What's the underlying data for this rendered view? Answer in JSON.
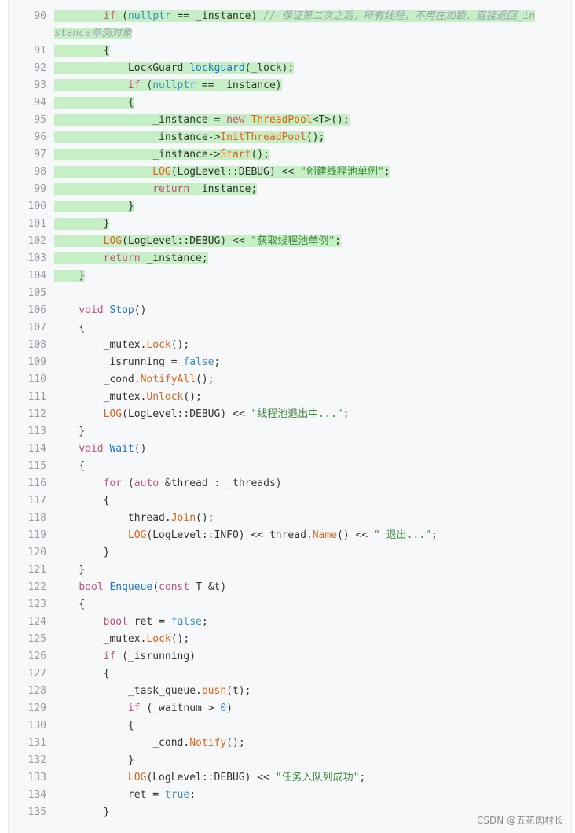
{
  "watermark": "CSDN @五花肉村长",
  "lines": [
    {
      "n": "90",
      "hl": true,
      "tall": true,
      "tokens": [
        {
          "t": "        "
        },
        {
          "t": "if",
          "c": "t-kw"
        },
        {
          "t": " ("
        },
        {
          "t": "nullptr",
          "c": "t-lit"
        },
        {
          "t": " == _instance) "
        },
        {
          "t": "// 保证第二次之后，所有线程，不用在加锁，直接返回_instance单例对象",
          "c": "t-com"
        }
      ]
    },
    {
      "n": "91",
      "hl": true,
      "tokens": [
        {
          "t": "        {"
        }
      ]
    },
    {
      "n": "92",
      "hl": true,
      "tokens": [
        {
          "t": "            LockGuard "
        },
        {
          "t": "lockguard",
          "c": "t-fn2"
        },
        {
          "t": "(_lock);"
        }
      ]
    },
    {
      "n": "93",
      "hl": true,
      "tokens": [
        {
          "t": "            "
        },
        {
          "t": "if",
          "c": "t-kw"
        },
        {
          "t": " ("
        },
        {
          "t": "nullptr",
          "c": "t-lit"
        },
        {
          "t": " == _instance)"
        }
      ]
    },
    {
      "n": "94",
      "hl": true,
      "tokens": [
        {
          "t": "            {"
        }
      ]
    },
    {
      "n": "95",
      "hl": true,
      "tokens": [
        {
          "t": "                _instance = "
        },
        {
          "t": "new",
          "c": "t-kw"
        },
        {
          "t": " "
        },
        {
          "t": "ThreadPool",
          "c": "t-ty"
        },
        {
          "t": "<T>();"
        }
      ]
    },
    {
      "n": "96",
      "hl": true,
      "tokens": [
        {
          "t": "                _instance->"
        },
        {
          "t": "InitThreadPool",
          "c": "t-fn"
        },
        {
          "t": "();"
        }
      ]
    },
    {
      "n": "97",
      "hl": true,
      "tokens": [
        {
          "t": "                _instance->"
        },
        {
          "t": "Start",
          "c": "t-fn"
        },
        {
          "t": "();"
        }
      ]
    },
    {
      "n": "98",
      "hl": true,
      "tokens": [
        {
          "t": "                "
        },
        {
          "t": "LOG",
          "c": "t-fn"
        },
        {
          "t": "(LogLevel::DEBUG) << "
        },
        {
          "t": "\"创建线程池单例\"",
          "c": "t-str"
        },
        {
          "t": ";"
        }
      ]
    },
    {
      "n": "99",
      "hl": true,
      "tokens": [
        {
          "t": "                "
        },
        {
          "t": "return",
          "c": "t-kw"
        },
        {
          "t": " _instance;"
        }
      ]
    },
    {
      "n": "100",
      "hl": true,
      "tokens": [
        {
          "t": "            }"
        }
      ]
    },
    {
      "n": "101",
      "hl": true,
      "tokens": [
        {
          "t": "        }"
        }
      ]
    },
    {
      "n": "102",
      "hl": true,
      "tokens": [
        {
          "t": "        "
        },
        {
          "t": "LOG",
          "c": "t-fn"
        },
        {
          "t": "(LogLevel::DEBUG) << "
        },
        {
          "t": "\"获取线程池单例\"",
          "c": "t-str"
        },
        {
          "t": ";"
        }
      ]
    },
    {
      "n": "103",
      "hl": true,
      "tokens": [
        {
          "t": "        "
        },
        {
          "t": "return",
          "c": "t-kw"
        },
        {
          "t": " _instance;"
        }
      ]
    },
    {
      "n": "104",
      "hl": true,
      "tokens": [
        {
          "t": "    }"
        }
      ]
    },
    {
      "n": "105",
      "tokens": [
        {
          "t": ""
        }
      ]
    },
    {
      "n": "106",
      "tokens": [
        {
          "t": "    "
        },
        {
          "t": "void",
          "c": "t-kw"
        },
        {
          "t": " "
        },
        {
          "t": "Stop",
          "c": "t-fn2"
        },
        {
          "t": "()"
        }
      ]
    },
    {
      "n": "107",
      "tokens": [
        {
          "t": "    {"
        }
      ]
    },
    {
      "n": "108",
      "tokens": [
        {
          "t": "        _mutex."
        },
        {
          "t": "Lock",
          "c": "t-fn"
        },
        {
          "t": "();"
        }
      ]
    },
    {
      "n": "109",
      "tokens": [
        {
          "t": "        _isrunning = "
        },
        {
          "t": "false",
          "c": "t-lit"
        },
        {
          "t": ";"
        }
      ]
    },
    {
      "n": "110",
      "tokens": [
        {
          "t": "        _cond."
        },
        {
          "t": "NotifyAll",
          "c": "t-fn"
        },
        {
          "t": "();"
        }
      ]
    },
    {
      "n": "111",
      "tokens": [
        {
          "t": "        _mutex."
        },
        {
          "t": "Unlock",
          "c": "t-fn"
        },
        {
          "t": "();"
        }
      ]
    },
    {
      "n": "112",
      "tokens": [
        {
          "t": "        "
        },
        {
          "t": "LOG",
          "c": "t-fn"
        },
        {
          "t": "(LogLevel::DEBUG) << "
        },
        {
          "t": "\"线程池退出中...\"",
          "c": "t-str"
        },
        {
          "t": ";"
        }
      ]
    },
    {
      "n": "113",
      "tokens": [
        {
          "t": "    }"
        }
      ]
    },
    {
      "n": "114",
      "tokens": [
        {
          "t": "    "
        },
        {
          "t": "void",
          "c": "t-kw"
        },
        {
          "t": " "
        },
        {
          "t": "Wait",
          "c": "t-fn2"
        },
        {
          "t": "()"
        }
      ]
    },
    {
      "n": "115",
      "tokens": [
        {
          "t": "    {"
        }
      ]
    },
    {
      "n": "116",
      "tokens": [
        {
          "t": "        "
        },
        {
          "t": "for",
          "c": "t-kw"
        },
        {
          "t": " ("
        },
        {
          "t": "auto",
          "c": "t-kw"
        },
        {
          "t": " &thread : _threads)"
        }
      ]
    },
    {
      "n": "117",
      "tokens": [
        {
          "t": "        {"
        }
      ]
    },
    {
      "n": "118",
      "tokens": [
        {
          "t": "            thread."
        },
        {
          "t": "Join",
          "c": "t-fn"
        },
        {
          "t": "();"
        }
      ]
    },
    {
      "n": "119",
      "tokens": [
        {
          "t": "            "
        },
        {
          "t": "LOG",
          "c": "t-fn"
        },
        {
          "t": "(LogLevel::INFO) << thread."
        },
        {
          "t": "Name",
          "c": "t-fn"
        },
        {
          "t": "() << "
        },
        {
          "t": "\" 退出...\"",
          "c": "t-str"
        },
        {
          "t": ";"
        }
      ]
    },
    {
      "n": "120",
      "tokens": [
        {
          "t": "        }"
        }
      ]
    },
    {
      "n": "121",
      "tokens": [
        {
          "t": "    }"
        }
      ]
    },
    {
      "n": "122",
      "tokens": [
        {
          "t": "    "
        },
        {
          "t": "bool",
          "c": "t-kw"
        },
        {
          "t": " "
        },
        {
          "t": "Enqueue",
          "c": "t-fn2"
        },
        {
          "t": "("
        },
        {
          "t": "const",
          "c": "t-kw"
        },
        {
          "t": " T &t)"
        }
      ]
    },
    {
      "n": "123",
      "tokens": [
        {
          "t": "    {"
        }
      ]
    },
    {
      "n": "124",
      "tokens": [
        {
          "t": "        "
        },
        {
          "t": "bool",
          "c": "t-kw"
        },
        {
          "t": " ret = "
        },
        {
          "t": "false",
          "c": "t-lit"
        },
        {
          "t": ";"
        }
      ]
    },
    {
      "n": "125",
      "tokens": [
        {
          "t": "        _mutex."
        },
        {
          "t": "Lock",
          "c": "t-fn"
        },
        {
          "t": "();"
        }
      ]
    },
    {
      "n": "126",
      "tokens": [
        {
          "t": "        "
        },
        {
          "t": "if",
          "c": "t-kw"
        },
        {
          "t": " (_isrunning)"
        }
      ]
    },
    {
      "n": "127",
      "tokens": [
        {
          "t": "        {"
        }
      ]
    },
    {
      "n": "128",
      "tokens": [
        {
          "t": "            _task_queue."
        },
        {
          "t": "push",
          "c": "t-fn"
        },
        {
          "t": "(t);"
        }
      ]
    },
    {
      "n": "129",
      "tokens": [
        {
          "t": "            "
        },
        {
          "t": "if",
          "c": "t-kw"
        },
        {
          "t": " (_waitnum > "
        },
        {
          "t": "0",
          "c": "t-lit"
        },
        {
          "t": ")"
        }
      ]
    },
    {
      "n": "130",
      "tokens": [
        {
          "t": "            {"
        }
      ]
    },
    {
      "n": "131",
      "tokens": [
        {
          "t": "                _cond."
        },
        {
          "t": "Notify",
          "c": "t-fn"
        },
        {
          "t": "();"
        }
      ]
    },
    {
      "n": "132",
      "tokens": [
        {
          "t": "            }"
        }
      ]
    },
    {
      "n": "133",
      "tokens": [
        {
          "t": "            "
        },
        {
          "t": "LOG",
          "c": "t-fn"
        },
        {
          "t": "(LogLevel::DEBUG) << "
        },
        {
          "t": "\"任务入队列成功\"",
          "c": "t-str"
        },
        {
          "t": ";"
        }
      ]
    },
    {
      "n": "134",
      "tokens": [
        {
          "t": "            ret = "
        },
        {
          "t": "true",
          "c": "t-lit"
        },
        {
          "t": ";"
        }
      ]
    },
    {
      "n": "135",
      "tokens": [
        {
          "t": "        }"
        }
      ]
    }
  ]
}
